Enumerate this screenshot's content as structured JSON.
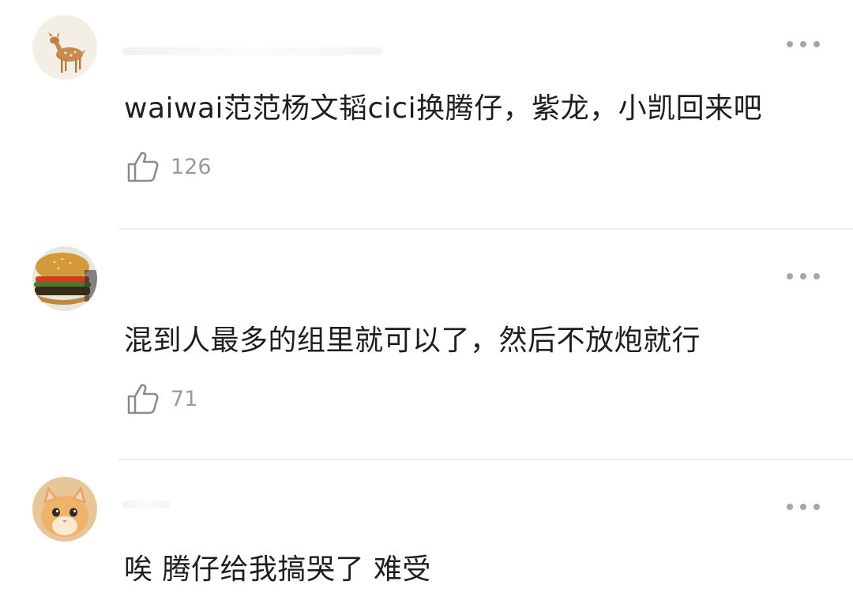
{
  "comments": [
    {
      "avatar_icon": "fawn-avatar",
      "text": "waiwai范范杨文韬cici换腾仔，紫龙，小凯回来吧",
      "likes": "126",
      "like_icon": "thumbs-up-icon",
      "more_icon": "more-dots-icon"
    },
    {
      "avatar_icon": "burger-avatar",
      "text": "混到人最多的组里就可以了，然后不放炮就行",
      "likes": "71",
      "like_icon": "thumbs-up-icon",
      "more_icon": "more-dots-icon"
    },
    {
      "avatar_icon": "cat-avatar",
      "text": "唉 腾仔给我搞哭了  难受",
      "more_icon": "more-dots-icon"
    }
  ],
  "colors": {
    "text": "#1e1e1e",
    "muted": "#9a9a9a",
    "dots": "#a6a6a6",
    "divider": "#ececec"
  }
}
